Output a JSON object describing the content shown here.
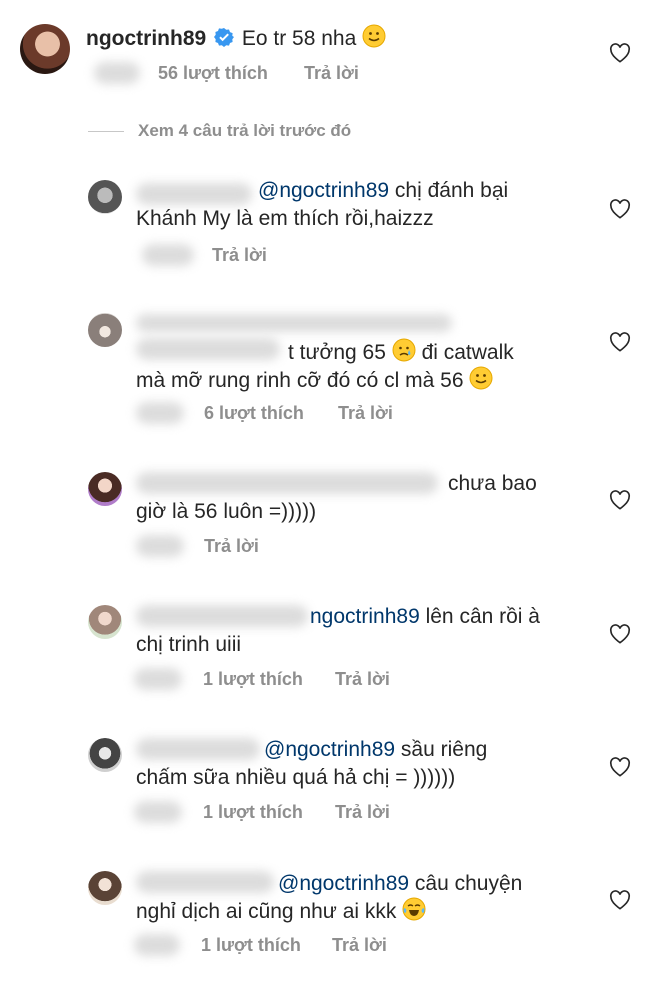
{
  "top_comment": {
    "username": "ngoctrinh89",
    "verified": true,
    "text": "Eo tr 58 nha",
    "emoji": "slightly-smiling-face",
    "likes": "56 lượt thích",
    "reply": "Trả lời"
  },
  "view_prev_replies": "Xem 4 câu trả lời trước đó",
  "replies": [
    {
      "mention": "@ngoctrinh89",
      "line1": " chị đánh bại",
      "line2": "Khánh My là em thích rồi,haizzz",
      "reply": "Trả lời"
    },
    {
      "line1": "t tưởng 65",
      "line1b": "đi catwalk",
      "line2": "mà mỡ rung rinh cỡ đó có cl mà 56",
      "likes": "6 lượt thích",
      "reply": "Trả lời"
    },
    {
      "line1": "chưa bao",
      "line2": "giờ là 56 luôn =)))))",
      "reply": "Trả lời"
    },
    {
      "mention": "ngoctrinh89",
      "line1": " lên cân rồi à",
      "line2": "chị trinh uiii",
      "likes": "1 lượt thích",
      "reply": "Trả lời"
    },
    {
      "mention": "@ngoctrinh89",
      "line1": " sầu riêng",
      "line2": "chấm sữa nhiều quá hả chị = ))))))",
      "likes": "1 lượt thích",
      "reply": "Trả lời"
    },
    {
      "mention": "@ngoctrinh89",
      "line1": " câu chuyện",
      "line2": "nghỉ dịch ai cũng như ai kkk",
      "likes": "1 lượt thích",
      "reply": "Trả lời"
    }
  ],
  "colors": {
    "text": "#262626",
    "meta": "#8e8e8e",
    "mention": "#00376b",
    "verified": "#3897f0"
  }
}
